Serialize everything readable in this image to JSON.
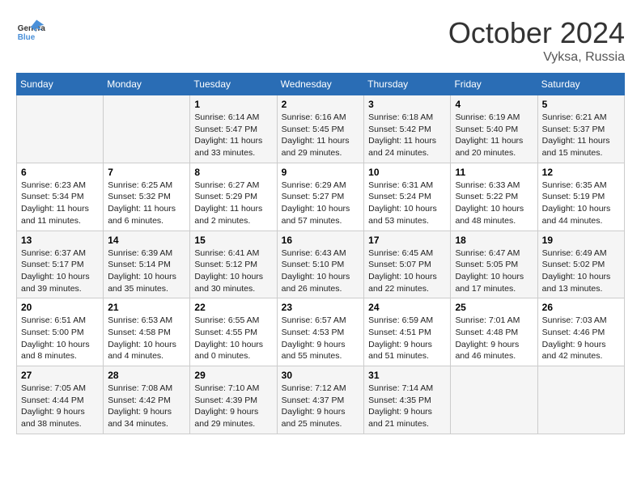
{
  "logo": {
    "line1": "General",
    "line2": "Blue"
  },
  "title": "October 2024",
  "location": "Vyksa, Russia",
  "days": [
    "Sunday",
    "Monday",
    "Tuesday",
    "Wednesday",
    "Thursday",
    "Friday",
    "Saturday"
  ],
  "weeks": [
    [
      {
        "num": "",
        "info": ""
      },
      {
        "num": "",
        "info": ""
      },
      {
        "num": "1",
        "info": "Sunrise: 6:14 AM\nSunset: 5:47 PM\nDaylight: 11 hours\nand 33 minutes."
      },
      {
        "num": "2",
        "info": "Sunrise: 6:16 AM\nSunset: 5:45 PM\nDaylight: 11 hours\nand 29 minutes."
      },
      {
        "num": "3",
        "info": "Sunrise: 6:18 AM\nSunset: 5:42 PM\nDaylight: 11 hours\nand 24 minutes."
      },
      {
        "num": "4",
        "info": "Sunrise: 6:19 AM\nSunset: 5:40 PM\nDaylight: 11 hours\nand 20 minutes."
      },
      {
        "num": "5",
        "info": "Sunrise: 6:21 AM\nSunset: 5:37 PM\nDaylight: 11 hours\nand 15 minutes."
      }
    ],
    [
      {
        "num": "6",
        "info": "Sunrise: 6:23 AM\nSunset: 5:34 PM\nDaylight: 11 hours\nand 11 minutes."
      },
      {
        "num": "7",
        "info": "Sunrise: 6:25 AM\nSunset: 5:32 PM\nDaylight: 11 hours\nand 6 minutes."
      },
      {
        "num": "8",
        "info": "Sunrise: 6:27 AM\nSunset: 5:29 PM\nDaylight: 11 hours\nand 2 minutes."
      },
      {
        "num": "9",
        "info": "Sunrise: 6:29 AM\nSunset: 5:27 PM\nDaylight: 10 hours\nand 57 minutes."
      },
      {
        "num": "10",
        "info": "Sunrise: 6:31 AM\nSunset: 5:24 PM\nDaylight: 10 hours\nand 53 minutes."
      },
      {
        "num": "11",
        "info": "Sunrise: 6:33 AM\nSunset: 5:22 PM\nDaylight: 10 hours\nand 48 minutes."
      },
      {
        "num": "12",
        "info": "Sunrise: 6:35 AM\nSunset: 5:19 PM\nDaylight: 10 hours\nand 44 minutes."
      }
    ],
    [
      {
        "num": "13",
        "info": "Sunrise: 6:37 AM\nSunset: 5:17 PM\nDaylight: 10 hours\nand 39 minutes."
      },
      {
        "num": "14",
        "info": "Sunrise: 6:39 AM\nSunset: 5:14 PM\nDaylight: 10 hours\nand 35 minutes."
      },
      {
        "num": "15",
        "info": "Sunrise: 6:41 AM\nSunset: 5:12 PM\nDaylight: 10 hours\nand 30 minutes."
      },
      {
        "num": "16",
        "info": "Sunrise: 6:43 AM\nSunset: 5:10 PM\nDaylight: 10 hours\nand 26 minutes."
      },
      {
        "num": "17",
        "info": "Sunrise: 6:45 AM\nSunset: 5:07 PM\nDaylight: 10 hours\nand 22 minutes."
      },
      {
        "num": "18",
        "info": "Sunrise: 6:47 AM\nSunset: 5:05 PM\nDaylight: 10 hours\nand 17 minutes."
      },
      {
        "num": "19",
        "info": "Sunrise: 6:49 AM\nSunset: 5:02 PM\nDaylight: 10 hours\nand 13 minutes."
      }
    ],
    [
      {
        "num": "20",
        "info": "Sunrise: 6:51 AM\nSunset: 5:00 PM\nDaylight: 10 hours\nand 8 minutes."
      },
      {
        "num": "21",
        "info": "Sunrise: 6:53 AM\nSunset: 4:58 PM\nDaylight: 10 hours\nand 4 minutes."
      },
      {
        "num": "22",
        "info": "Sunrise: 6:55 AM\nSunset: 4:55 PM\nDaylight: 10 hours\nand 0 minutes."
      },
      {
        "num": "23",
        "info": "Sunrise: 6:57 AM\nSunset: 4:53 PM\nDaylight: 9 hours\nand 55 minutes."
      },
      {
        "num": "24",
        "info": "Sunrise: 6:59 AM\nSunset: 4:51 PM\nDaylight: 9 hours\nand 51 minutes."
      },
      {
        "num": "25",
        "info": "Sunrise: 7:01 AM\nSunset: 4:48 PM\nDaylight: 9 hours\nand 46 minutes."
      },
      {
        "num": "26",
        "info": "Sunrise: 7:03 AM\nSunset: 4:46 PM\nDaylight: 9 hours\nand 42 minutes."
      }
    ],
    [
      {
        "num": "27",
        "info": "Sunrise: 7:05 AM\nSunset: 4:44 PM\nDaylight: 9 hours\nand 38 minutes."
      },
      {
        "num": "28",
        "info": "Sunrise: 7:08 AM\nSunset: 4:42 PM\nDaylight: 9 hours\nand 34 minutes."
      },
      {
        "num": "29",
        "info": "Sunrise: 7:10 AM\nSunset: 4:39 PM\nDaylight: 9 hours\nand 29 minutes."
      },
      {
        "num": "30",
        "info": "Sunrise: 7:12 AM\nSunset: 4:37 PM\nDaylight: 9 hours\nand 25 minutes."
      },
      {
        "num": "31",
        "info": "Sunrise: 7:14 AM\nSunset: 4:35 PM\nDaylight: 9 hours\nand 21 minutes."
      },
      {
        "num": "",
        "info": ""
      },
      {
        "num": "",
        "info": ""
      }
    ]
  ]
}
